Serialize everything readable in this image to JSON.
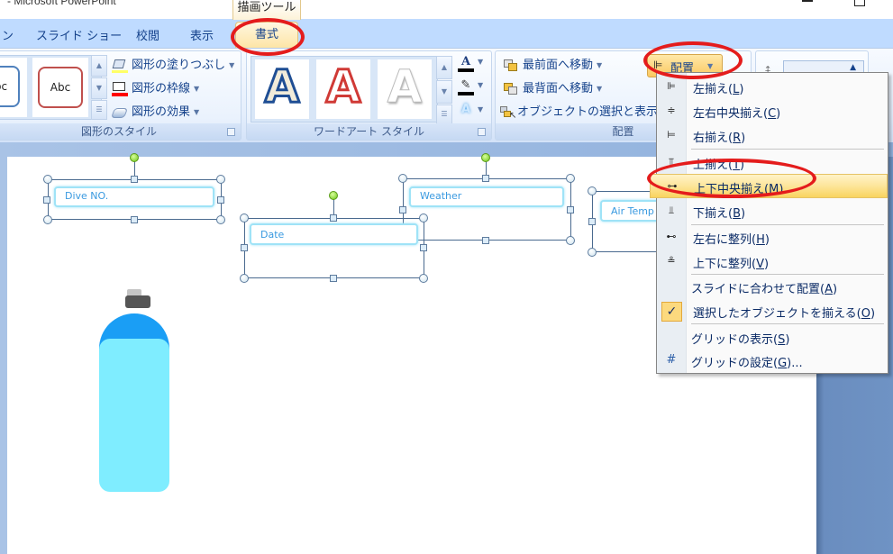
{
  "window": {
    "title": "- Microsoft PowerPoint",
    "minimize_icon": "minimize-icon",
    "maximize_icon": "maximize-icon"
  },
  "contextual_tab_header": "描画ツール",
  "tabs": [
    {
      "label": "ン"
    },
    {
      "label": "スライド ショー"
    },
    {
      "label": "校閲"
    },
    {
      "label": "表示"
    }
  ],
  "active_tab": "書式",
  "ribbon": {
    "shape_styles": {
      "label": "図形のスタイル",
      "gallery": [
        "bc",
        "Abc"
      ],
      "commands": [
        {
          "label": "図形の塗りつぶし",
          "icon": "paint-bucket-icon"
        },
        {
          "label": "図形の枠線",
          "icon": "pen-outline-icon"
        },
        {
          "label": "図形の効果",
          "icon": "shape-effects-icon"
        }
      ]
    },
    "wordart_styles": {
      "label": "ワードアート スタイル",
      "gallery": [
        "A",
        "A",
        "A"
      ],
      "commands": [
        {
          "icon": "text-fill-icon",
          "glyph": "A"
        },
        {
          "icon": "text-outline-icon",
          "glyph": "✎"
        },
        {
          "icon": "text-effects-icon",
          "glyph": "A"
        }
      ]
    },
    "arrange": {
      "label": "配置",
      "commands": [
        {
          "label": "最前面へ移動",
          "icon": "bring-to-front-icon"
        },
        {
          "label": "最背面へ移動",
          "icon": "send-to-back-icon"
        },
        {
          "label": "オブジェクトの選択と表示",
          "icon": "selection-pane-icon"
        }
      ],
      "align_button": "配置"
    }
  },
  "slide": {
    "fields": [
      {
        "label": "Dive NO."
      },
      {
        "label": "Date"
      },
      {
        "label": "Weather"
      },
      {
        "label": "Air Temp"
      }
    ]
  },
  "align_menu": {
    "items": [
      {
        "label": "左揃え",
        "key": "L",
        "icon": "align-left-icon",
        "glyph": "⊫"
      },
      {
        "label": "左右中央揃え",
        "key": "C",
        "icon": "align-center-icon",
        "glyph": "≑"
      },
      {
        "label": "右揃え",
        "key": "R",
        "icon": "align-right-icon",
        "glyph": "⊨"
      },
      {
        "label": "上揃え",
        "key": "T",
        "icon": "align-top-icon",
        "glyph": "⫪"
      },
      {
        "label": "上下中央揃え",
        "key": "M",
        "icon": "align-middle-icon",
        "glyph": "⊶"
      },
      {
        "label": "下揃え",
        "key": "B",
        "icon": "align-bottom-icon",
        "glyph": "⫫"
      },
      {
        "label": "左右に整列",
        "key": "H",
        "icon": "distribute-horizontally-icon",
        "glyph": "⊷"
      },
      {
        "label": "上下に整列",
        "key": "V",
        "icon": "distribute-vertically-icon",
        "glyph": "≗"
      },
      {
        "label": "スライドに合わせて配置",
        "key": "A",
        "icon": "",
        "glyph": ""
      },
      {
        "label": "選択したオブジェクトを揃える",
        "key": "O",
        "icon": "check-icon",
        "glyph": "✓"
      },
      {
        "label": "グリッドの表示",
        "key": "S",
        "icon": "",
        "glyph": ""
      },
      {
        "label": "グリッドの設定",
        "key": "G",
        "suffix": "...",
        "icon": "grid-icon",
        "glyph": "#"
      }
    ],
    "highlighted_index": 4,
    "checked_index": 9
  },
  "colors": {
    "annotation_red": "#e41c1c",
    "highlight": "#fde59a",
    "tank_dome": "#1a9ef5",
    "tank_body": "#7fedff",
    "field_text": "#3a9ae0"
  }
}
